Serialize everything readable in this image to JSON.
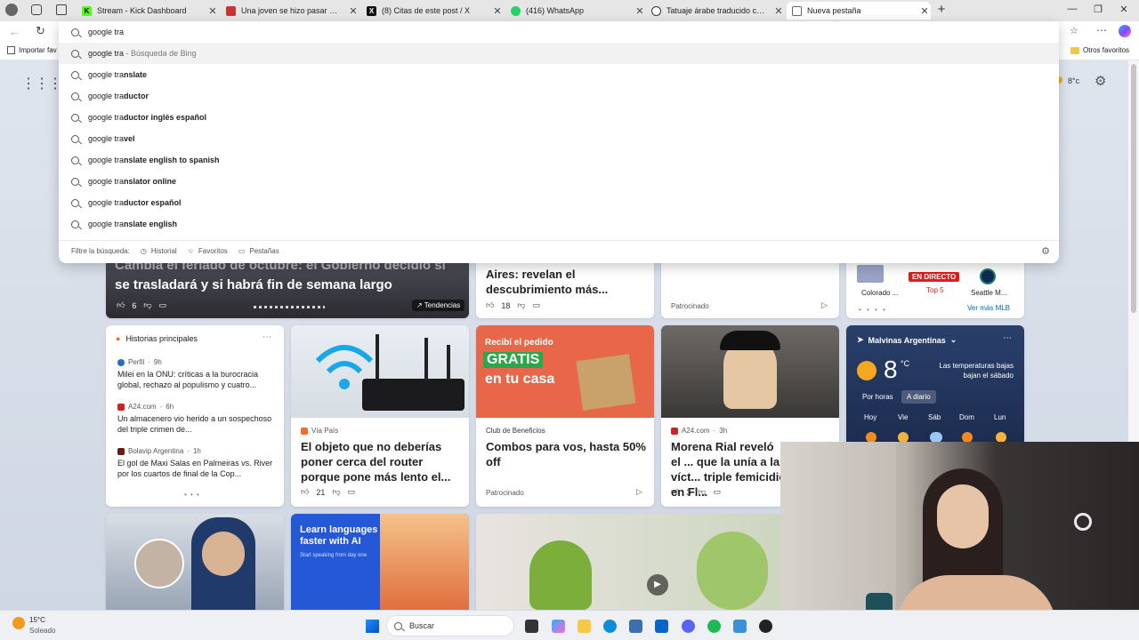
{
  "tabs": [
    {
      "title": "Stream - Kick Dashboard",
      "icon": "kick-icon",
      "color": "#53fc18",
      "letter": "K"
    },
    {
      "title": "Una joven se hizo pasar por una",
      "icon": "news-icon",
      "color": "#d33",
      "letter": ""
    },
    {
      "title": "(8) Citas de este post / X",
      "icon": "x-icon",
      "color": "#111",
      "letter": "X"
    },
    {
      "title": "(416) WhatsApp",
      "icon": "whatsapp-icon",
      "color": "#25d366",
      "letter": ""
    },
    {
      "title": "Tatuaje árabe traducido como \"e",
      "icon": "link-icon",
      "color": "#444",
      "letter": ""
    },
    {
      "title": "Nueva pestaña",
      "icon": "new-tab-icon",
      "color": "#777",
      "letter": ""
    }
  ],
  "omnibox": {
    "query": "google tra",
    "suggestions": [
      {
        "typed": "google tra",
        "rest": "",
        "sub": " - Búsqueda de Bing"
      },
      {
        "typed": "google tra",
        "rest": "nslate",
        "sub": ""
      },
      {
        "typed": "google tra",
        "rest": "ductor",
        "sub": ""
      },
      {
        "typed": "google tra",
        "rest": "ductor inglés español",
        "sub": ""
      },
      {
        "typed": "google tra",
        "rest": "vel",
        "sub": ""
      },
      {
        "typed": "google tra",
        "rest": "nslate english to spanish",
        "sub": ""
      },
      {
        "typed": "google tra",
        "rest": "nslator online",
        "sub": ""
      },
      {
        "typed": "google tra",
        "rest": "ductor español",
        "sub": ""
      },
      {
        "typed": "google tra",
        "rest": "nslate english",
        "sub": ""
      }
    ],
    "filter_label": "Filtre la búsqueda:",
    "filters": [
      "Historial",
      "Favoritos",
      "Pestañas"
    ]
  },
  "favbar": {
    "import": "Importar fav",
    "others": "Otros favoritos"
  },
  "header_weather": "8°c",
  "hero": {
    "line1": "Cambia el feriado de octubre: el Gobierno decidió si",
    "line2": "se trasladará y si habrá fin de semana largo",
    "likes": "6",
    "trend": "Tendencias"
  },
  "card_aires": {
    "headline": "Aires: revelan el descubrimiento más...",
    "likes": "18"
  },
  "card_sponsored1": {
    "label": "Patrocinado"
  },
  "mlb": {
    "team1": "Colorado ...",
    "status": "EN DIRECTO",
    "inning": "Top 5",
    "team2": "Seattle M...",
    "more": "Ver más MLB"
  },
  "top_stories": {
    "title": "Historias principales",
    "items": [
      {
        "source": "Perfil",
        "time": "9h",
        "text": "Milei en la ONU: críticas a la burocracia global, rechazo al populismo y cuatro...",
        "color": "#2a6ebb"
      },
      {
        "source": "A24.com",
        "time": "6h",
        "text": "Un almacenero vio herido a un sospechoso del triple crimen de...",
        "color": "#c22"
      },
      {
        "source": "Bolavip Argentina",
        "time": "1h",
        "text": "El gol de Maxi Salas en Palmeiras vs. River por los cuartos de final de la Cop...",
        "color": "#6b1a1a"
      }
    ]
  },
  "card_router": {
    "source": "Vía País",
    "headline": "El objeto que no deberías poner cerca del router porque pone más lento el...",
    "likes": "21"
  },
  "card_promo": {
    "source": "Club de Beneficios",
    "headline": "Combos para vos, hasta 50% off",
    "label": "Patrocinado",
    "img_text1": "Recibí el pedido",
    "img_text2": "GRATIS",
    "img_text3": "en tu casa"
  },
  "card_morena": {
    "source": "A24.com",
    "time": "3h",
    "headline": "Morena Rial reveló el ... que la unía a las víct... triple femicidio en Fl...",
    "likes": "3"
  },
  "weather": {
    "location": "Malvinas Argentinas",
    "temp": "8",
    "unit": "°C",
    "note": "Las temperaturas bajas bajan el sábado",
    "tab1": "Por horas",
    "tab2": "A diario",
    "days": [
      "Hoy",
      "Vie",
      "Sáb",
      "Dom",
      "Lun"
    ]
  },
  "card_languages": {
    "title": "Learn languages faster with AI",
    "sub": "Start speaking from day one"
  },
  "taskbar": {
    "temp": "15°C",
    "condition": "Soleado",
    "search": "Buscar"
  },
  "colors": {
    "accent": "#0067c0",
    "orange": "#f26b2c",
    "live": "#e21b1b"
  }
}
